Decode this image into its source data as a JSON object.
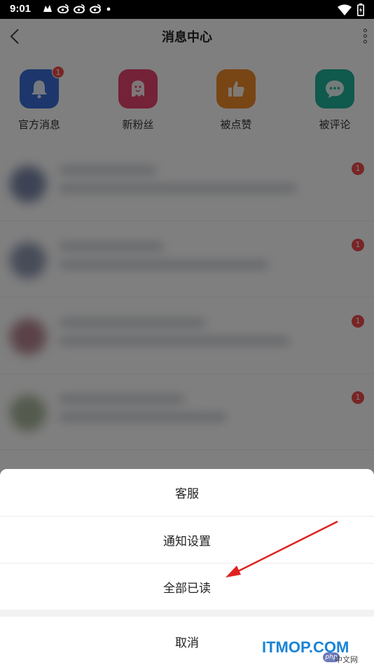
{
  "status_bar": {
    "time": "9:01",
    "left_icons": [
      "notification-icon",
      "weibo-icon",
      "weibo-icon",
      "weibo-icon",
      "dot-icon"
    ],
    "right_icons": [
      "wifi-icon",
      "battery-icon"
    ]
  },
  "header": {
    "title": "消息中心",
    "back_icon": "chevron-left-icon",
    "more_icon": "more-vertical-icon"
  },
  "categories": [
    {
      "label": "官方消息",
      "icon": "bell-icon",
      "color": "#3b6fd9",
      "badge": "1"
    },
    {
      "label": "新粉丝",
      "icon": "ghost-icon",
      "color": "#e8456f",
      "badge": ""
    },
    {
      "label": "被点赞",
      "icon": "thumbs-up-icon",
      "color": "#f08a2a",
      "badge": ""
    },
    {
      "label": "被评论",
      "icon": "comment-icon",
      "color": "#1fb39a",
      "badge": ""
    }
  ],
  "message_list": {
    "badges": [
      "1",
      "1",
      "1",
      "1"
    ]
  },
  "action_sheet": {
    "items": [
      "客服",
      "通知设置",
      "全部已读"
    ],
    "cancel": "取消"
  },
  "watermark": {
    "text": "ITMOP.COM",
    "badge": "php",
    "sub": "中文网"
  },
  "colors": {
    "badge": "#f04a4a",
    "annotation_arrow": "#e02020",
    "watermark": "#1a84d6"
  }
}
